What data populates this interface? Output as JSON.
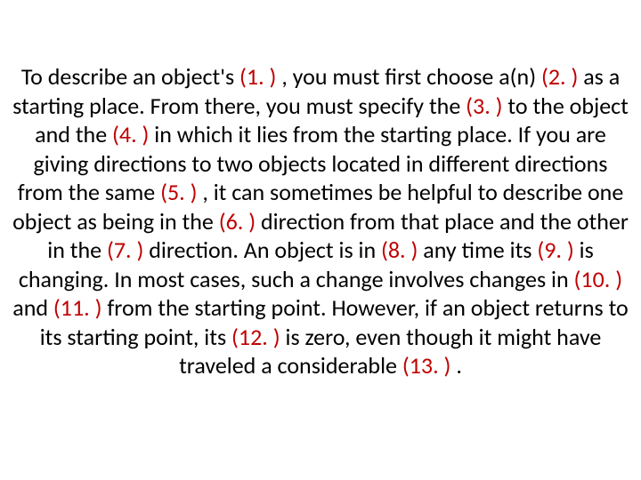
{
  "text": {
    "p1a": "To describe an object's ",
    "b1": "(1. )",
    "p1b": " , you must first choose a(n) ",
    "b2": "(2. )",
    "p2a": " as a starting place. From there, you must specify the ",
    "b3": "(3. )",
    "p3a": " to the object and the ",
    "b4": "(4. )",
    "p4a": " in which it lies from the starting place. If you are giving directions to two objects located in different directions from the same ",
    "b5": "(5. )",
    "p5a": " , it can sometimes be helpful to describe one object as being in the ",
    "b6": "(6. )",
    "p6a": " direction from that place and the other in the ",
    "b7": "(7. )",
    "p7a": " direction. An object is in ",
    "b8": "(8. )",
    "p8a": " any time its ",
    "b9": "(9. )",
    "p9a": " is changing. In most cases, such a change involves changes in ",
    "b10": "(10. )",
    "p10a": " and ",
    "b11": "(11. )",
    "p11a": " from the starting point. However, if an object returns to its starting point, its ",
    "b12": "(12. )",
    "p12a": " is zero, even though it might have traveled a considerable ",
    "b13": "(13. )",
    "p13a": " ."
  }
}
